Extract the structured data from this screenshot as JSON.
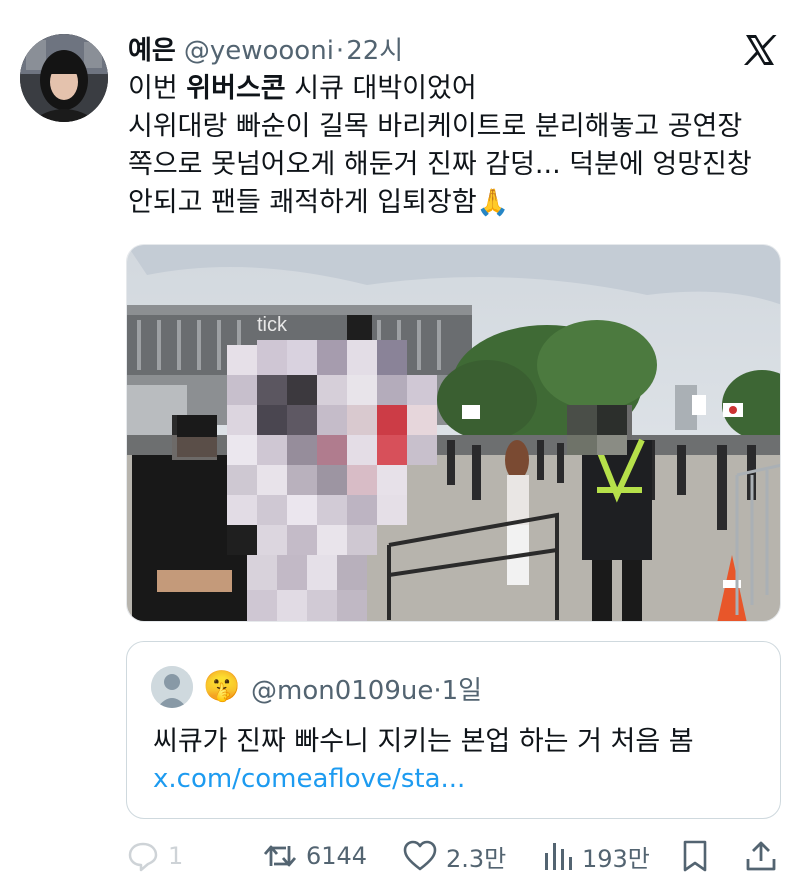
{
  "tweet": {
    "author_name": "예은",
    "handle": "@yewoooni",
    "separator": "·",
    "time": "22시",
    "text_line1_pre": "이번 ",
    "text_line1_bold": "위버스콘",
    "text_line1_post": " 시큐 대박이었어",
    "text_line2": "시위대랑 빠순이 길목 바리케이트로 분리해놓고 공연장",
    "text_line3": "쪽으로 못넘어오게 해둔거 진짜 감덩... 덕분에 엉망진창",
    "text_line4": "안되고 팬들 쾌적하게 입퇴장함",
    "text_emoji": "🙏",
    "image_sign_text": "tick"
  },
  "quote": {
    "emoji": "🤫",
    "handle": "@mon0109ue",
    "separator": "·",
    "time": "1일",
    "text": "씨큐가 진짜 빠수니 지키는 본업 하는 거 처음 봄",
    "link": "x.com/comeaflove/sta..."
  },
  "actions": {
    "reply_count": "1",
    "retweet_count": "6144",
    "like_count": "2.3만",
    "views_count": "193만"
  },
  "colors": {
    "text": "#0f1419",
    "secondary": "#536471",
    "link": "#1d9bf0",
    "border": "#cfd9de"
  },
  "icons": [
    "x-logo-icon",
    "reply-icon",
    "retweet-icon",
    "like-icon",
    "views-icon",
    "bookmark-icon",
    "share-icon"
  ]
}
